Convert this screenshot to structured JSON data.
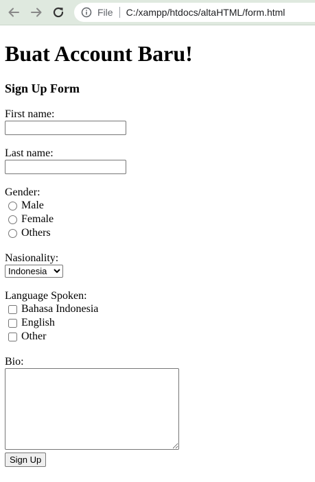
{
  "browser": {
    "file_label": "File",
    "url": "C:/xampp/htdocs/altaHTML/form.html"
  },
  "page": {
    "heading": "Buat Account Baru!",
    "subheading": "Sign Up Form",
    "first_name_label": "First name:",
    "first_name_value": "",
    "last_name_label": "Last name:",
    "last_name_value": "",
    "gender_label": "Gender:",
    "gender_options": [
      "Male",
      "Female",
      "Others"
    ],
    "nationality_label": "Nasionality:",
    "nationality_selected": "Indonesia",
    "language_label": "Language Spoken:",
    "language_options": [
      "Bahasa Indonesia",
      "English",
      "Other"
    ],
    "bio_label": "Bio:",
    "bio_value": "",
    "submit_label": "Sign Up"
  }
}
